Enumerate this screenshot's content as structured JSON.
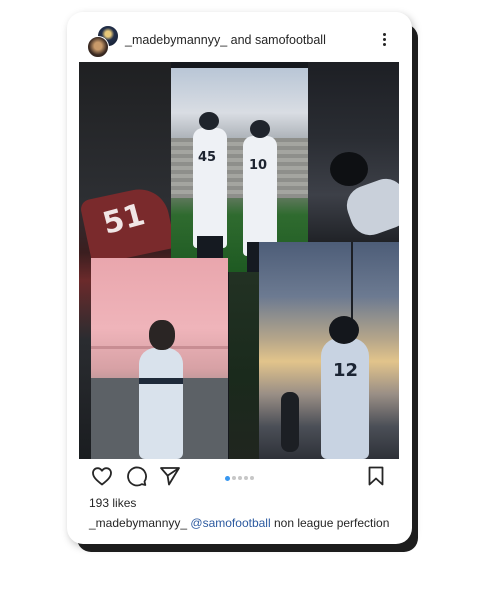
{
  "post": {
    "author": "_madebymannyy_",
    "connector": "and",
    "collaborator": "samofootball",
    "likes_text": "193 likes",
    "caption_user": "_madebymannyy_",
    "caption_mention": "@samofootball",
    "caption_text": "non league perfection",
    "carousel": {
      "total": 5,
      "active_index": 0
    }
  },
  "photo": {
    "jersey_numbers": [
      "45",
      "10",
      "51",
      "12"
    ]
  },
  "colors": {
    "accent": "#3897f0",
    "mention": "#2c5aa0",
    "text": "#262626"
  },
  "icons": {
    "like": "heart-icon",
    "comment": "comment-icon",
    "share": "paper-plane-icon",
    "save": "bookmark-icon",
    "more": "more-vertical-icon"
  }
}
